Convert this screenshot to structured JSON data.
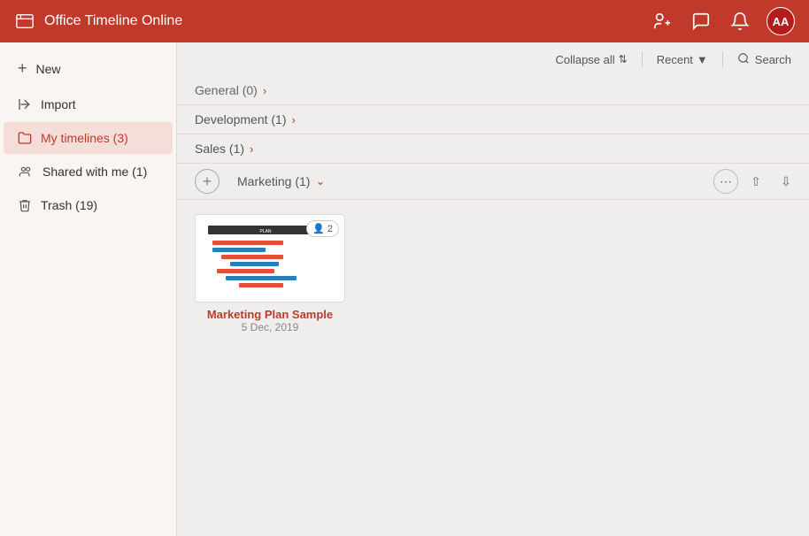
{
  "header": {
    "logo_label": "Office Timeline Online",
    "add_user_icon": "person-add",
    "chat_icon": "chat",
    "bell_icon": "bell",
    "avatar_label": "AA"
  },
  "toolbar": {
    "collapse_label": "Collapse all",
    "recent_label": "Recent",
    "search_label": "Search"
  },
  "sidebar": {
    "items": [
      {
        "id": "new",
        "icon": "+",
        "label": "New"
      },
      {
        "id": "import",
        "icon": "→|",
        "label": "Import"
      },
      {
        "id": "my-timelines",
        "icon": "📁",
        "label": "My timelines (3)",
        "active": true
      },
      {
        "id": "shared-with-me",
        "icon": "👥",
        "label": "Shared with me (1)"
      },
      {
        "id": "trash",
        "icon": "🗑",
        "label": "Trash (19)"
      }
    ]
  },
  "groups": [
    {
      "id": "general",
      "label": "General (0)",
      "expanded": false,
      "count": 0
    },
    {
      "id": "development",
      "label": "Development (1)",
      "expanded": false,
      "count": 1
    },
    {
      "id": "sales",
      "label": "Sales (1)",
      "expanded": false,
      "count": 1
    },
    {
      "id": "marketing",
      "label": "Marketing (1)",
      "expanded": true,
      "count": 1
    }
  ],
  "marketing_card": {
    "name": "Marketing Plan Sample",
    "date": "5 Dec, 2019",
    "collaborators_count": "2"
  }
}
